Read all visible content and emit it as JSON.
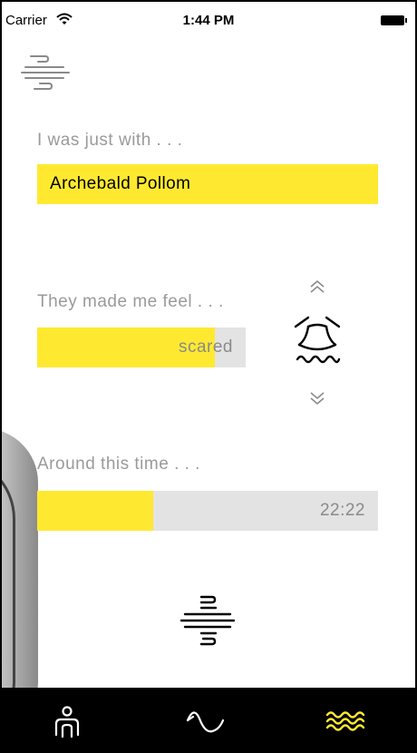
{
  "status_bar": {
    "carrier": "Carrier",
    "time": "1:44 PM"
  },
  "menu": {
    "icon": "menu-lines-icon"
  },
  "with_section": {
    "label": "I was just with . . .",
    "value": "Archebald Pollom"
  },
  "feel_section": {
    "label": "They made me feel . . .",
    "value": "scared",
    "level": 0.85,
    "up_icon": "chevron-double-up-icon",
    "down_icon": "chevron-double-down-icon",
    "emotion_icon": "scared-face-icon"
  },
  "time_section": {
    "label": "Around this time . . .",
    "value": "22:22",
    "level": 0.34
  },
  "add_icon": "entry-lines-icon",
  "tab_bar": {
    "tabs": [
      {
        "icon": "person-icon",
        "active": false
      },
      {
        "icon": "wave-icon",
        "active": false
      },
      {
        "icon": "triple-wave-icon",
        "active": true
      }
    ]
  },
  "colors": {
    "accent": "#ffe930",
    "track": "#e3e3e3",
    "label": "#9a9a9a",
    "tab_bar": "#000000",
    "tab_inactive": "#ffffff",
    "tab_active": "#ffe930"
  }
}
